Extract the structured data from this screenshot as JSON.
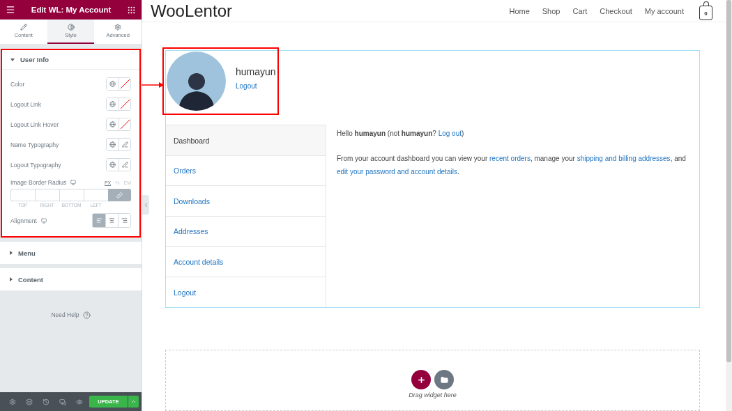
{
  "panel": {
    "title": "Edit WL: My Account",
    "tabs": [
      {
        "label": "Content",
        "selected": false
      },
      {
        "label": "Style",
        "selected": true
      },
      {
        "label": "Advanced",
        "selected": false
      }
    ],
    "sections": [
      {
        "title": "User Info",
        "expanded": true,
        "highlighted": true,
        "controls": [
          {
            "kind": "color",
            "label": "Color"
          },
          {
            "kind": "color",
            "label": "Logout Link"
          },
          {
            "kind": "color",
            "label": "Logout Link Hover"
          },
          {
            "kind": "typography",
            "label": "Name Typography"
          },
          {
            "kind": "typography",
            "label": "Logout Typography"
          },
          {
            "kind": "dimensions",
            "label": "Image Border Radius",
            "units": [
              {
                "label": "PX",
                "selected": true
              },
              {
                "label": "%",
                "selected": false
              },
              {
                "label": "EM",
                "selected": false
              }
            ],
            "fields": [
              "TOP",
              "RIGHT",
              "BOTTOM",
              "LEFT"
            ],
            "linked": true
          },
          {
            "kind": "choose",
            "label": "Alignment",
            "options": [
              {
                "selected": true
              },
              {
                "selected": false
              },
              {
                "selected": false
              }
            ]
          }
        ]
      },
      {
        "title": "Menu",
        "expanded": false,
        "highlighted": false
      },
      {
        "title": "Content",
        "expanded": false,
        "highlighted": false
      }
    ],
    "help": "Need Help",
    "update": "UPDATE"
  },
  "site": {
    "logo": "WooLentor",
    "nav": [
      "Home",
      "Shop",
      "Cart",
      "Checkout",
      "My account"
    ],
    "cart_count": "0"
  },
  "account": {
    "highlighted": true,
    "username": "humayun",
    "logout": "Logout",
    "menu": [
      {
        "label": "Dashboard",
        "selected": true
      },
      {
        "label": "Orders",
        "selected": false
      },
      {
        "label": "Downloads",
        "selected": false
      },
      {
        "label": "Addresses",
        "selected": false
      },
      {
        "label": "Account details",
        "selected": false
      },
      {
        "label": "Logout",
        "selected": false
      }
    ],
    "greeting": [
      {
        "kind": "text",
        "text": "Hello **humayun** (not **humayun**? "
      },
      {
        "kind": "link",
        "text": "Log out"
      },
      {
        "kind": "text",
        "text": ")"
      }
    ],
    "intro": [
      {
        "kind": "text",
        "text": "From your account dashboard you can view your "
      },
      {
        "kind": "link",
        "text": "recent orders"
      },
      {
        "kind": "text",
        "text": ", manage your "
      },
      {
        "kind": "link",
        "text": "shipping and billing addresses"
      },
      {
        "kind": "text",
        "text": ", and "
      },
      {
        "kind": "link",
        "text": "edit your password and account details"
      },
      {
        "kind": "text",
        "text": "."
      }
    ]
  },
  "dropzone": {
    "hint": "Drag widget here"
  }
}
